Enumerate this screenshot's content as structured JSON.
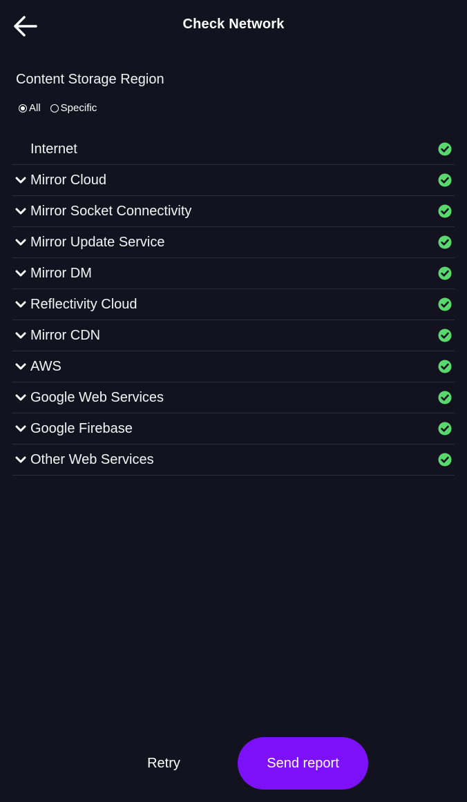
{
  "header": {
    "title": "Check Network",
    "back_icon": "arrow-left-icon"
  },
  "region": {
    "title": "Content Storage Region",
    "options": [
      {
        "label": "All",
        "selected": true
      },
      {
        "label": "Specific",
        "selected": false
      }
    ]
  },
  "checks": [
    {
      "label": "Internet",
      "expandable": false,
      "status": "ok"
    },
    {
      "label": "Mirror Cloud",
      "expandable": true,
      "status": "ok"
    },
    {
      "label": "Mirror Socket Connectivity",
      "expandable": true,
      "status": "ok"
    },
    {
      "label": "Mirror Update Service",
      "expandable": true,
      "status": "ok"
    },
    {
      "label": "Mirror DM",
      "expandable": true,
      "status": "ok"
    },
    {
      "label": "Reflectivity Cloud",
      "expandable": true,
      "status": "ok"
    },
    {
      "label": "Mirror CDN",
      "expandable": true,
      "status": "ok"
    },
    {
      "label": "AWS",
      "expandable": true,
      "status": "ok"
    },
    {
      "label": "Google Web Services",
      "expandable": true,
      "status": "ok"
    },
    {
      "label": "Google Firebase",
      "expandable": true,
      "status": "ok"
    },
    {
      "label": "Other Web Services",
      "expandable": true,
      "status": "ok"
    }
  ],
  "footer": {
    "retry_label": "Retry",
    "send_label": "Send report"
  },
  "colors": {
    "background": "#12131f",
    "accent": "#7c10f7",
    "success": "#59d86d",
    "divider": "#2b2d3b"
  }
}
